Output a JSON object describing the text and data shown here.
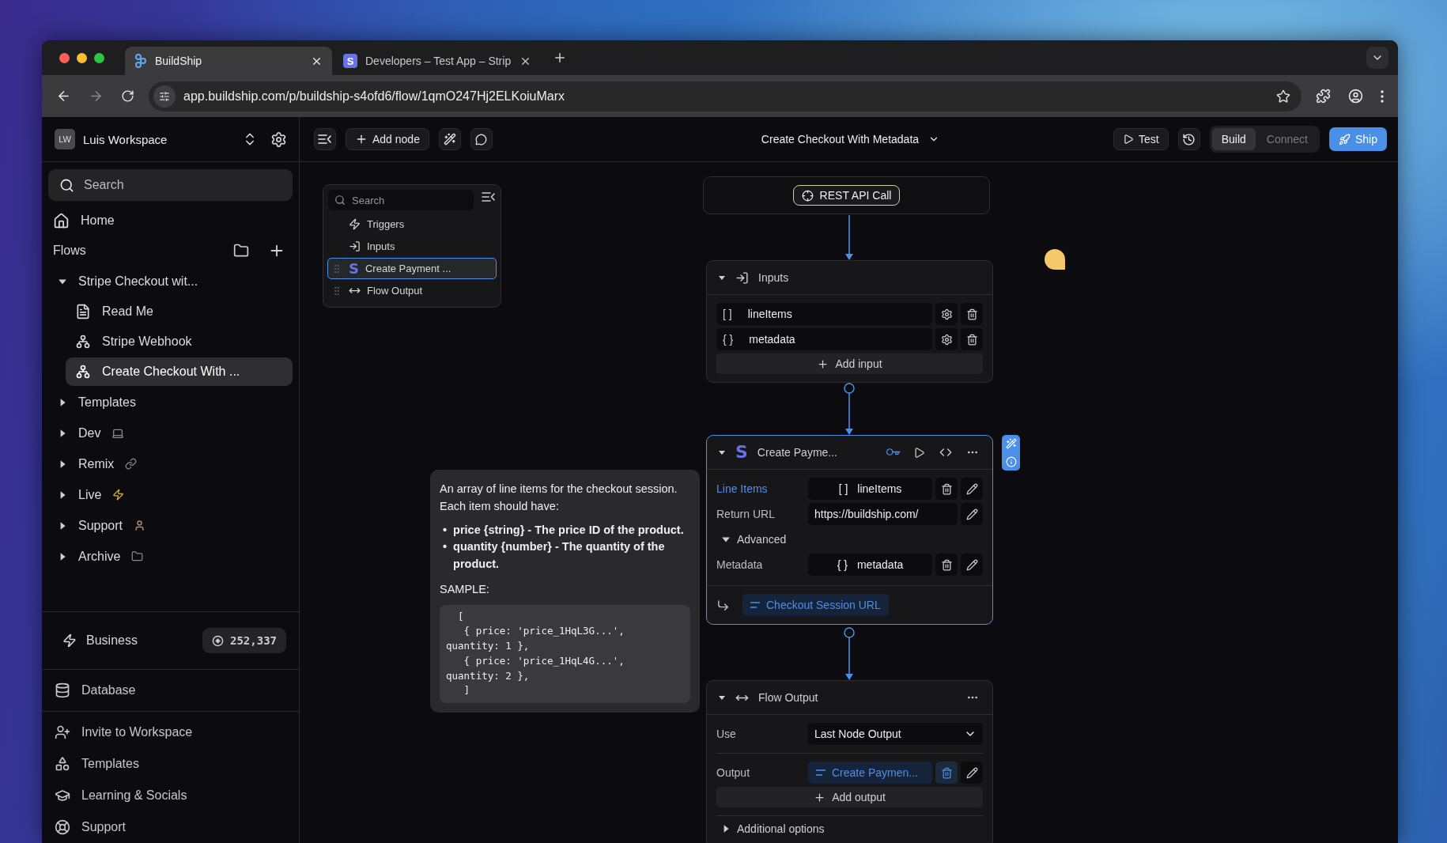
{
  "browser": {
    "tabs": [
      {
        "title": "BuildShip",
        "kind": "buildship",
        "selected": true
      },
      {
        "title": "Developers – Test App – Strip",
        "kind": "stripe",
        "logo": "S",
        "selected": false
      }
    ],
    "url": "app.buildship.com/p/buildship-s4ofd6/flow/1qmO247Hj2ELKoiuMarx"
  },
  "workspace": {
    "initials": "LW",
    "name": "Luis Workspace"
  },
  "sidebar": {
    "search_placeholder": "Search",
    "home": "Home",
    "flows_label": "Flows",
    "tree": [
      {
        "label": "Stripe Checkout wit...",
        "kind": "plain",
        "expanded": true,
        "children": [
          {
            "label": "Read Me",
            "kind": "doc",
            "selected": false
          },
          {
            "label": "Stripe Webhook",
            "kind": "flow",
            "selected": false
          },
          {
            "label": "Create Checkout With ...",
            "kind": "flow",
            "selected": true
          }
        ]
      },
      {
        "label": "Templates",
        "kind": "plain",
        "expanded": false
      },
      {
        "label": "Dev",
        "kind": "laptop",
        "expanded": false
      },
      {
        "label": "Remix",
        "kind": "link",
        "expanded": false
      },
      {
        "label": "Live",
        "kind": "bolt",
        "expanded": false
      },
      {
        "label": "Support",
        "kind": "person",
        "expanded": false
      },
      {
        "label": "Archive",
        "kind": "folder",
        "expanded": false
      }
    ],
    "plan": {
      "label": "Business",
      "credits": "252,337"
    },
    "database": "Database",
    "links": [
      {
        "label": "Invite to Workspace",
        "kind": "invite"
      },
      {
        "label": "Templates",
        "kind": "templates"
      },
      {
        "label": "Learning & Socials",
        "kind": "learn"
      },
      {
        "label": "Support",
        "kind": "support"
      }
    ]
  },
  "toolbar": {
    "add_node": "Add node",
    "flow_title": "Create Checkout With Metadata",
    "test": "Test",
    "modes": [
      {
        "label": "Build",
        "selected": true
      },
      {
        "label": "Connect",
        "selected": false
      }
    ],
    "ship": "Ship"
  },
  "outline": {
    "search_placeholder": "Search",
    "items": [
      {
        "label": "Triggers",
        "kind": "trigger",
        "selected": false,
        "draggable": false
      },
      {
        "label": "Inputs",
        "kind": "inputs",
        "selected": false,
        "draggable": false
      },
      {
        "label": "Create Payment ...",
        "kind": "stripe",
        "logo": "S",
        "selected": true,
        "draggable": true
      },
      {
        "label": "Flow Output",
        "kind": "output",
        "selected": false,
        "draggable": true
      }
    ]
  },
  "trigger_node": {
    "label": "REST API Call"
  },
  "inputs_node": {
    "title": "Inputs",
    "expanded": true,
    "items": [
      {
        "symbol": "[ ]",
        "name": "lineItems"
      },
      {
        "symbol": "{ }",
        "name": "metadata"
      }
    ],
    "add_label": "Add input"
  },
  "payment_node": {
    "title": "Create Payme...",
    "logo": "S",
    "selected": true,
    "expanded": true,
    "fields": [
      {
        "label": "Line Items",
        "kind": "variable",
        "symbol": "[ ]",
        "value": "lineItems",
        "highlighted": true
      },
      {
        "label": "Return URL",
        "kind": "text",
        "value": "https://buildship.com/",
        "highlighted": false
      }
    ],
    "advanced": {
      "label": "Advanced",
      "expanded": true,
      "fields": [
        {
          "label": "Metadata",
          "kind": "variable",
          "symbol": "{ }",
          "value": "metadata",
          "highlighted": false
        }
      ]
    },
    "output": "Checkout Session URL"
  },
  "output_node": {
    "title": "Flow Output",
    "expanded": true,
    "use_label": "Use",
    "use_value": "Last Node Output",
    "output_label": "Output",
    "output_value": "Create Paymen...",
    "add_label": "Add output",
    "additional": {
      "label": "Additional options",
      "expanded": false
    }
  },
  "tooltip": {
    "intro": "An array of line items for the checkout session. Each item should have:",
    "bullets": [
      {
        "marker": "•",
        "text": "price {string} - The price ID of the product."
      },
      {
        "marker": "•",
        "text": "quantity {number} - The quantity of the product."
      }
    ],
    "sample_label": "SAMPLE:",
    "sample_lines": [
      "  [",
      "   { price: 'price_1HqL3G...',",
      "quantity: 1 },",
      "   { price: 'price_1HqL4G...',",
      "quantity: 2 },",
      "   ]"
    ]
  }
}
